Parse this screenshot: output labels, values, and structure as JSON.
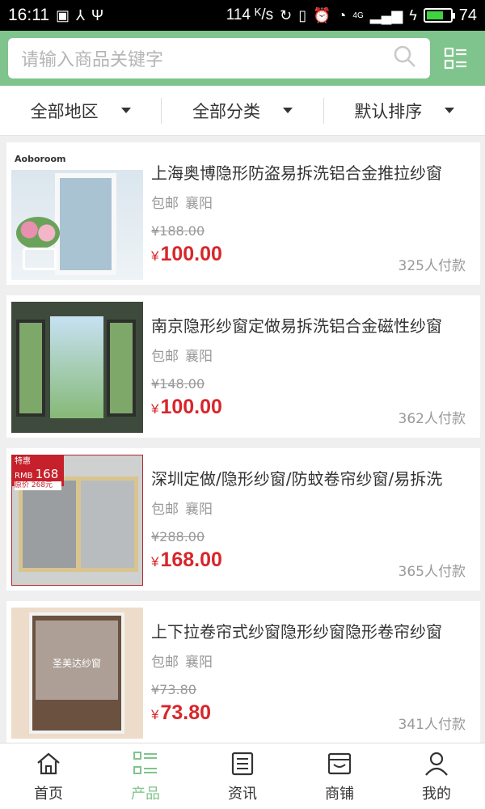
{
  "status_bar": {
    "time": "16:11",
    "speed": "114 ᴷ/s",
    "network": "4G",
    "battery_percent": "74",
    "battery_level": 0.74
  },
  "search": {
    "placeholder": "请输入商品关键字"
  },
  "filters": [
    {
      "label": "全部地区"
    },
    {
      "label": "全部分类"
    },
    {
      "label": "默认排序"
    }
  ],
  "products": [
    {
      "title": "上海奥博隐形防盗易拆洗铝合金推拉纱窗",
      "shipping": "包邮",
      "location": "襄阳",
      "original_price": "¥188.00",
      "currency": "¥",
      "price": "100.00",
      "paid_count": "325人付款",
      "thumb_text": "Aoboroom"
    },
    {
      "title": "南京隐形纱窗定做易拆洗铝合金磁性纱窗",
      "shipping": "包邮",
      "location": "襄阳",
      "original_price": "¥148.00",
      "currency": "¥",
      "price": "100.00",
      "paid_count": "362人付款"
    },
    {
      "title": "深圳定做/隐形纱窗/防蚊卷帘纱窗/易拆洗",
      "shipping": "包邮",
      "location": "襄阳",
      "original_price": "¥288.00",
      "currency": "¥",
      "price": "168.00",
      "paid_count": "365人付款",
      "thumb_tag_line1": "特惠",
      "thumb_tag_line2": "RMB",
      "thumb_tag_price": "168",
      "thumb_tag_orig": "原价 268元"
    },
    {
      "title": "上下拉卷帘式纱窗隐形纱窗隐形卷帘纱窗",
      "shipping": "包邮",
      "location": "襄阳",
      "original_price": "¥73.80",
      "currency": "¥",
      "price": "73.80",
      "paid_count": "341人付款",
      "thumb_text": "圣美达纱窗"
    }
  ],
  "bottom_nav": [
    {
      "label": "首页",
      "icon": "home-icon",
      "active": false
    },
    {
      "label": "产品",
      "icon": "grid-list-icon",
      "active": true
    },
    {
      "label": "资讯",
      "icon": "news-icon",
      "active": false
    },
    {
      "label": "商铺",
      "icon": "store-icon",
      "active": false
    },
    {
      "label": "我的",
      "icon": "person-icon",
      "active": false
    }
  ],
  "colors": {
    "accent": "#7fc48c",
    "price": "#d8262a"
  }
}
